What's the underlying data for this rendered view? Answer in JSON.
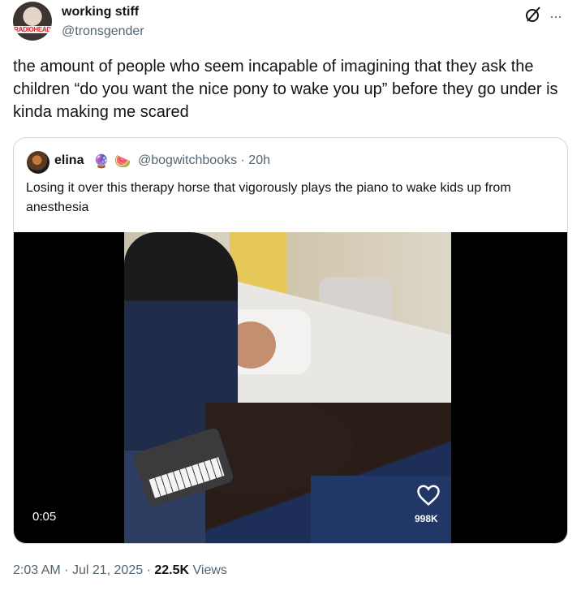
{
  "tweet": {
    "avatar_text": "RADIOHEAD",
    "display_name": "working stiff",
    "handle": "@tronsgender",
    "more": "···",
    "text": "the amount of people who seem incapable of imagining that they ask the children “do you want the nice pony to wake you up” before they go under is kinda making me scared",
    "time": "2:03 AM",
    "date": "Jul 21, 2025",
    "views_count": "22.5K",
    "views_label": "Views"
  },
  "quote": {
    "display_name": "elina",
    "emoji_1": "🔮",
    "emoji_2": "🍉",
    "handle_time": "@bogwitchbooks · 20h",
    "text": "Losing it over this therapy horse that vigorously plays the piano to wake kids up from anesthesia",
    "video": {
      "timestamp": "0:05",
      "like_count": "998K"
    }
  }
}
